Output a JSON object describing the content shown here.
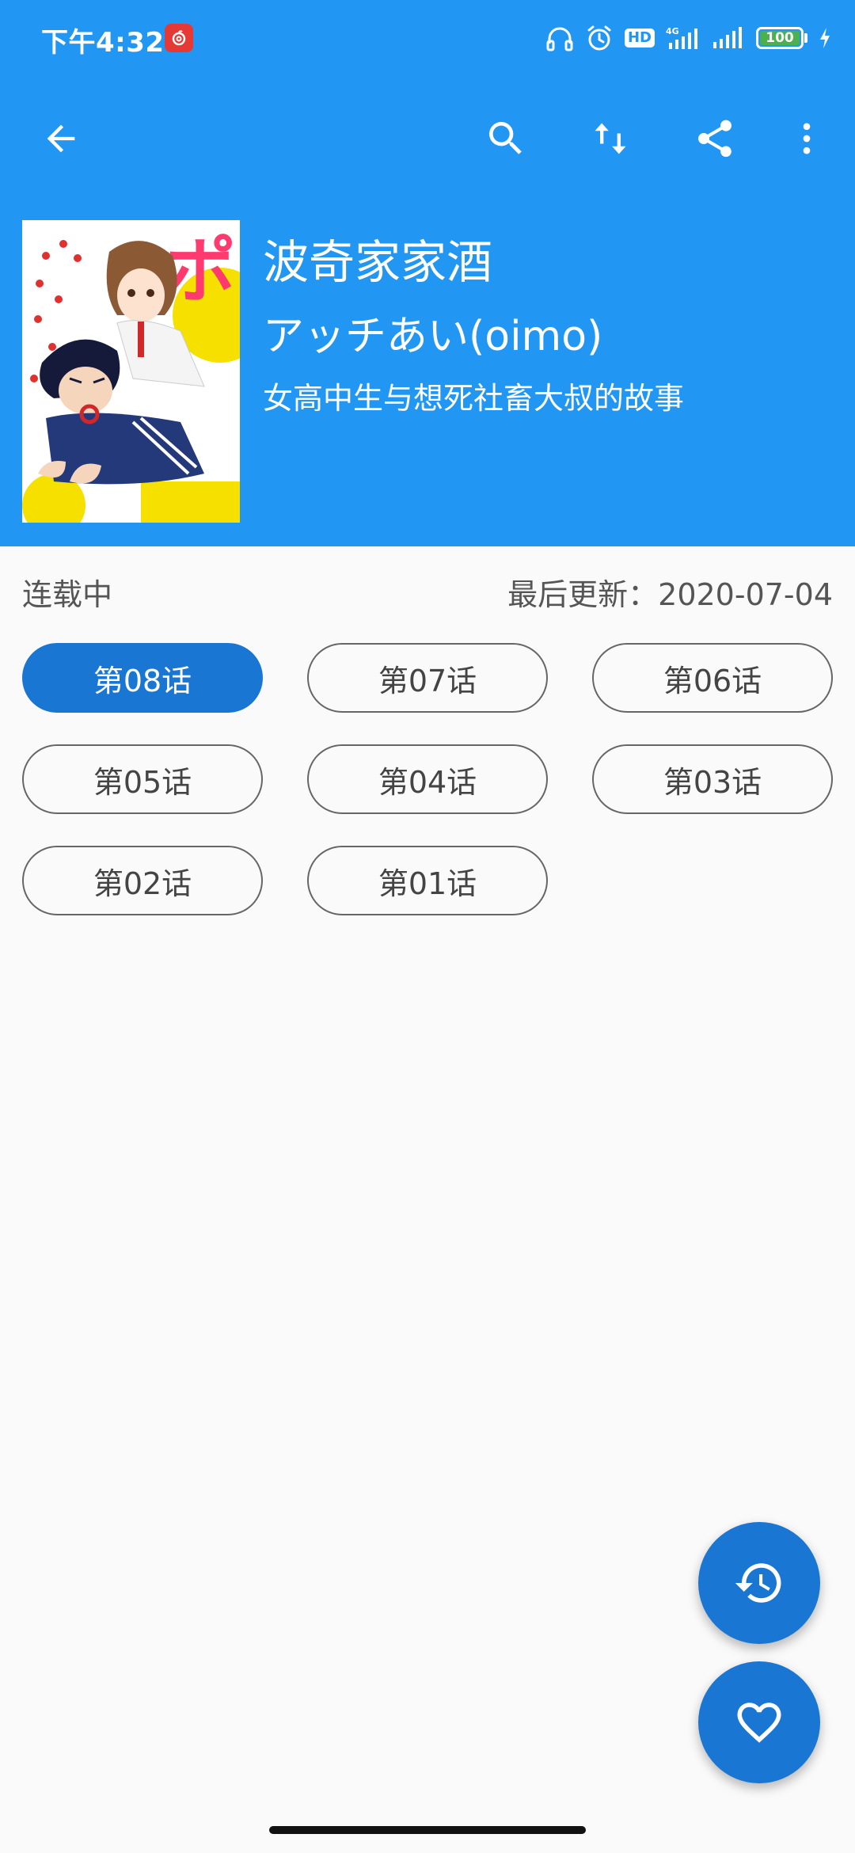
{
  "status_bar": {
    "time": "下午4:32",
    "network": "4G",
    "hd": "HD",
    "battery": "100"
  },
  "toolbar": {
    "icons": [
      "back-arrow-icon",
      "search-icon",
      "sort-icon",
      "share-icon",
      "more-vert-icon"
    ]
  },
  "comic": {
    "title": "波奇家家酒",
    "author": "アッチあい(oimo)",
    "description": "女高中生与想死社畜大叔的故事"
  },
  "info": {
    "status": "连载中",
    "last_update": "最后更新：2020-07-04"
  },
  "chapters": [
    {
      "label": "第08话",
      "active": true
    },
    {
      "label": "第07话",
      "active": false
    },
    {
      "label": "第06话",
      "active": false
    },
    {
      "label": "第05话",
      "active": false
    },
    {
      "label": "第04话",
      "active": false
    },
    {
      "label": "第03话",
      "active": false
    },
    {
      "label": "第02话",
      "active": false
    },
    {
      "label": "第01话",
      "active": false
    }
  ],
  "colors": {
    "header": "#2196f3",
    "accent": "#1976d2",
    "background": "#fafafa"
  },
  "fabs": [
    "history-icon",
    "favorite-heart-icon"
  ]
}
